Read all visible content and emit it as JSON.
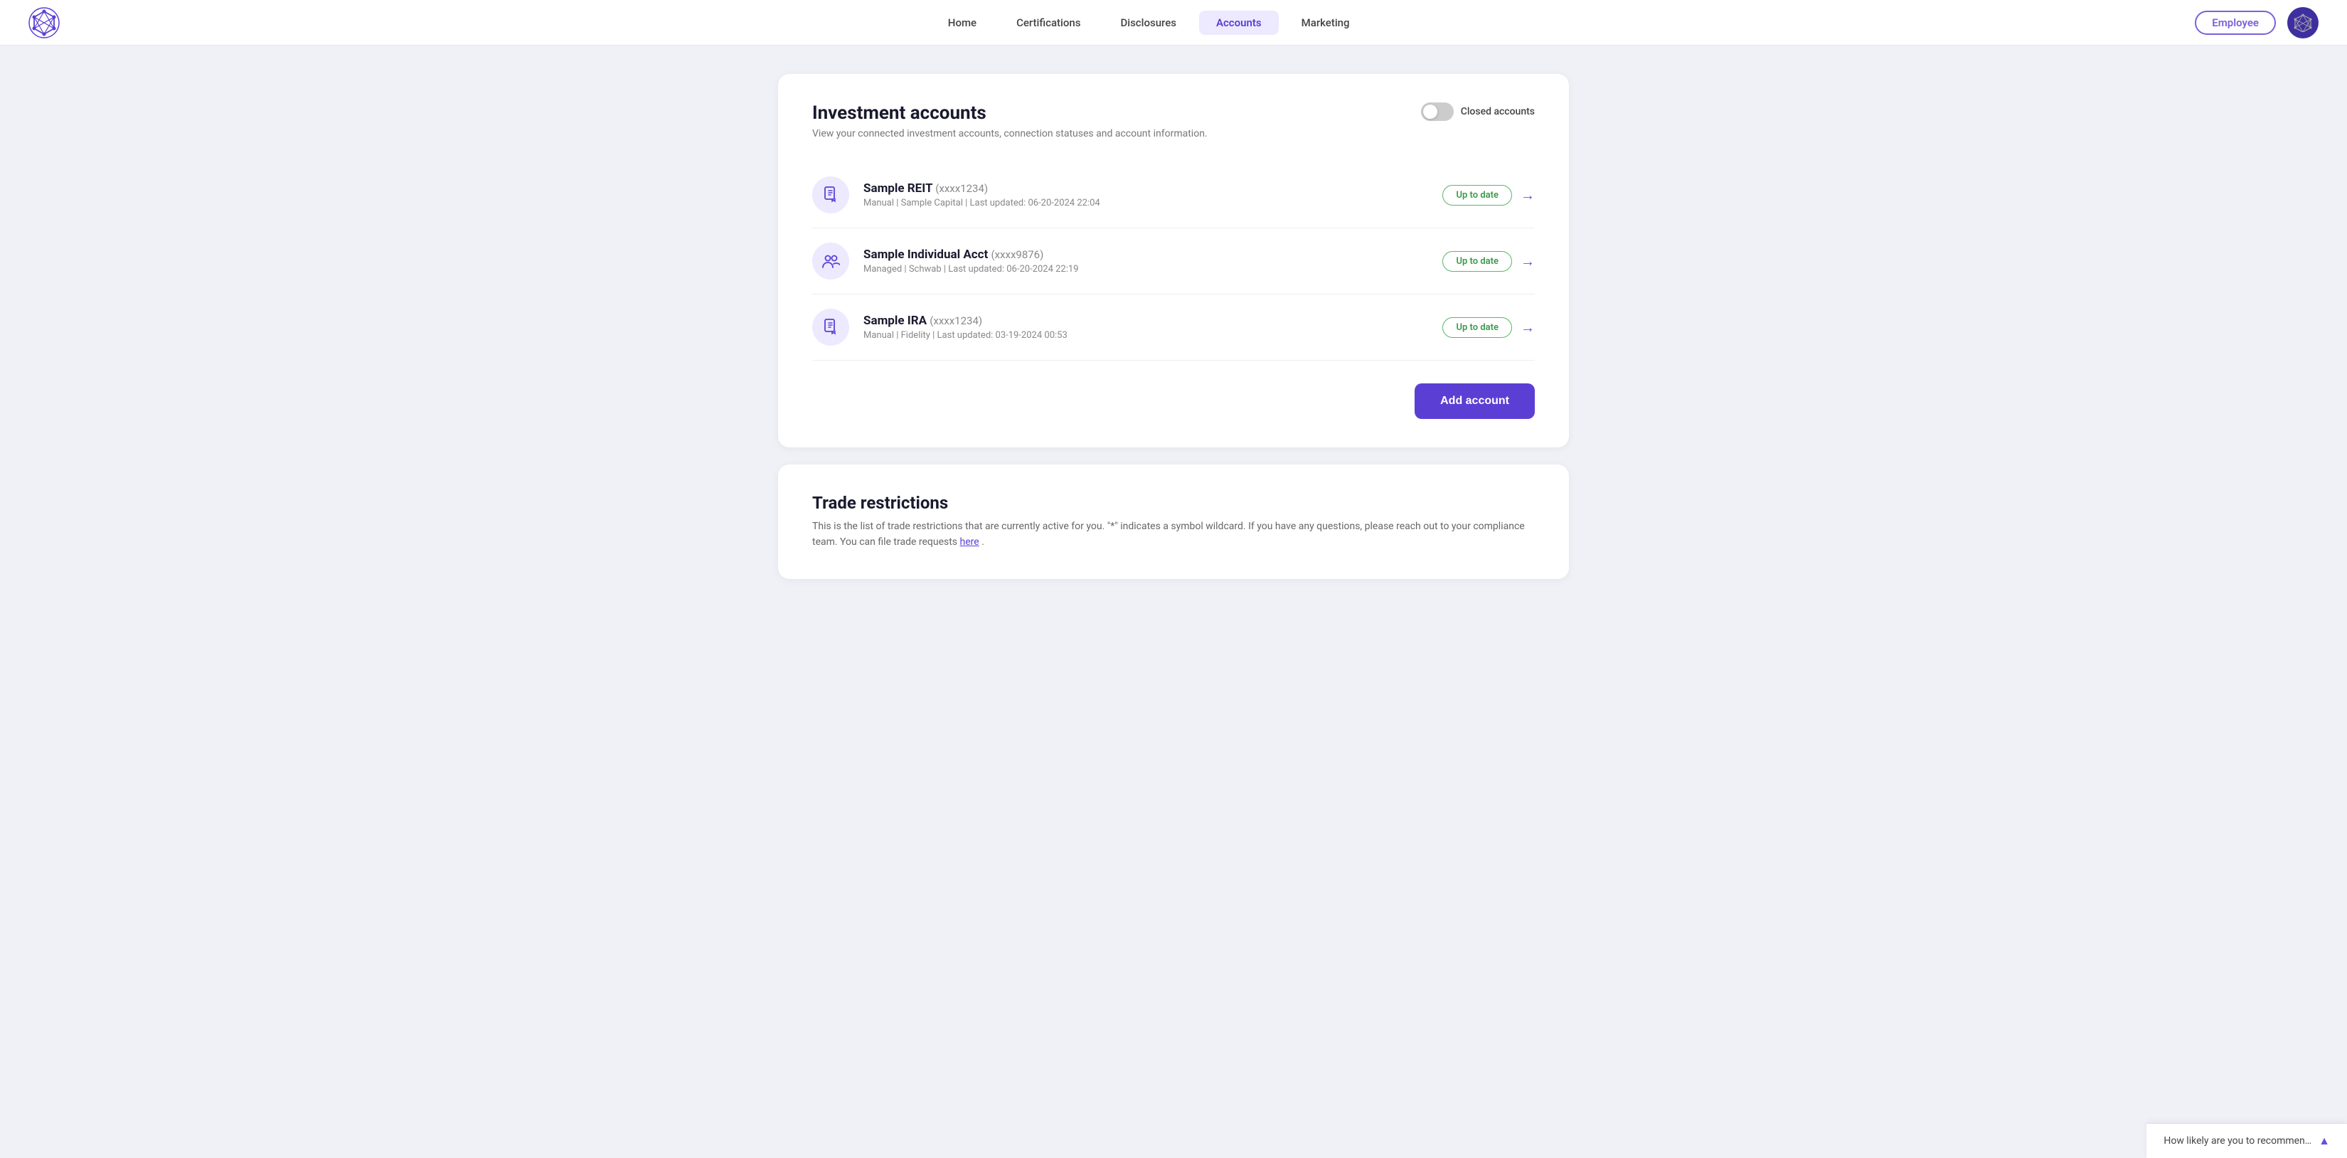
{
  "header": {
    "nav": [
      {
        "label": "Home",
        "active": false
      },
      {
        "label": "Certifications",
        "active": false
      },
      {
        "label": "Disclosures",
        "active": false
      },
      {
        "label": "Accounts",
        "active": true
      },
      {
        "label": "Marketing",
        "active": false
      }
    ],
    "employee_badge": "Employee",
    "avatar_icon": "🔷"
  },
  "investment_accounts": {
    "title": "Investment accounts",
    "subtitle": "View your connected investment accounts, connection statuses and account information.",
    "closed_accounts_label": "Closed accounts",
    "accounts": [
      {
        "name": "Sample REIT",
        "account_number": "(xxxx1234)",
        "meta": "Manual | Sample Capital | Last updated: 06-20-2024 22:04",
        "status": "Up to date",
        "icon_type": "document"
      },
      {
        "name": "Sample Individual Acct",
        "account_number": "(xxxx9876)",
        "meta": "Managed | Schwab | Last updated: 06-20-2024 22:19",
        "status": "Up to date",
        "icon_type": "people"
      },
      {
        "name": "Sample IRA",
        "account_number": "(xxxx1234)",
        "meta": "Manual | Fidelity | Last updated: 03-19-2024 00:53",
        "status": "Up to date",
        "icon_type": "document"
      }
    ],
    "add_account_label": "Add account"
  },
  "trade_restrictions": {
    "title": "Trade restrictions",
    "subtitle": "This is the list of trade restrictions that are currently active for you. \"*\" indicates a symbol wildcard. If you have any questions, please reach out to your compliance team. You can file trade requests ",
    "link_text": "here",
    "subtitle_end": "."
  },
  "feedback": {
    "text": "How likely are you to recommen…"
  }
}
